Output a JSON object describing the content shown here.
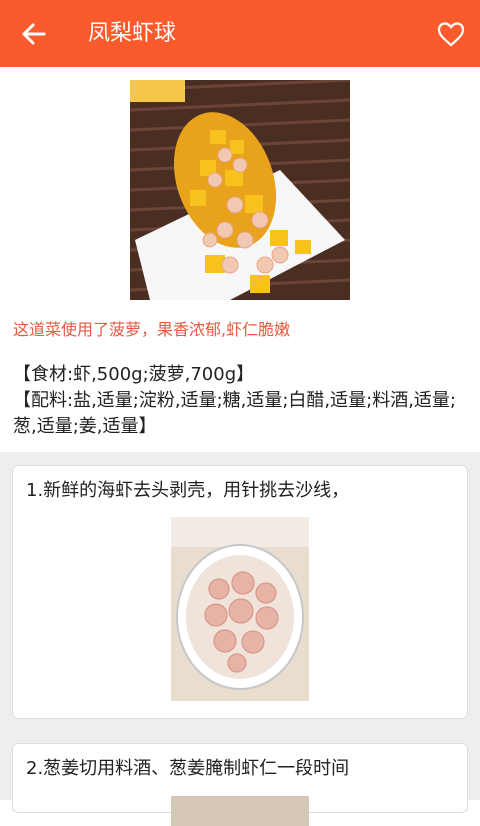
{
  "header": {
    "title": "凤梨虾球",
    "back_icon": "arrow-left-icon",
    "favorite_icon": "heart-outline-icon",
    "bar_color": "#fb5a2c"
  },
  "recipe": {
    "intro": "这道菜使用了菠萝，果香浓郁,虾仁脆嫩",
    "ingredients_main": "【食材:虾,500g;菠萝,700g】",
    "ingredients_seasoning": "【配料:盐,适量;淀粉,适量;糖,适量;白醋,适量;料酒,适量;葱,适量;姜,适量】"
  },
  "steps": [
    {
      "text": "1.新鲜的海虾去头剥壳，用针挑去沙线，"
    },
    {
      "text": "2.葱姜切用料酒、葱姜腌制虾仁一段时间"
    }
  ]
}
